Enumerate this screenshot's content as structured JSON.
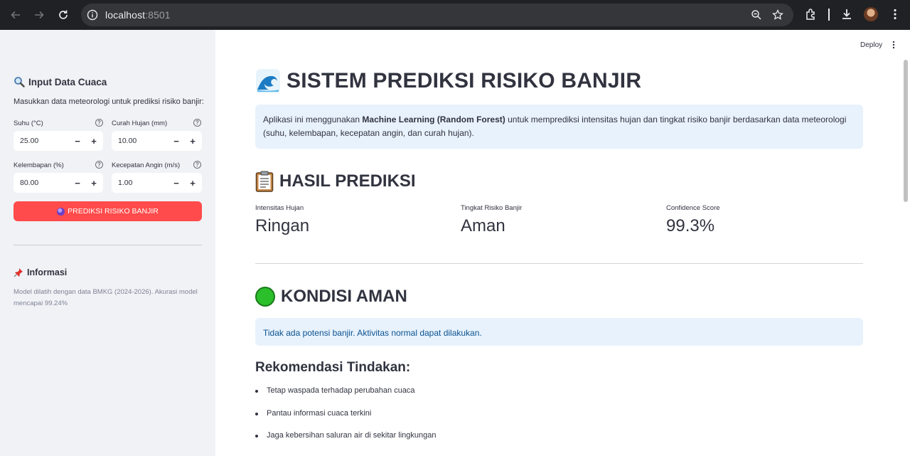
{
  "browser": {
    "url_host": "localhost",
    "url_port": ":8501"
  },
  "sidebar": {
    "title": "Input Data Cuaca",
    "description": "Masukkan data meteorologi untuk prediksi risiko banjir:",
    "fields": [
      {
        "label": "Suhu (°C)",
        "value": "25.00"
      },
      {
        "label": "Curah Hujan (mm)",
        "value": "10.00"
      },
      {
        "label": "Kelembapan (%)",
        "value": "80.00"
      },
      {
        "label": "Kecepatan Angin (m/s)",
        "value": "1.00"
      }
    ],
    "stepper_minus": "−",
    "stepper_plus": "+",
    "help_mark": "?",
    "predict_button": "PREDIKSI RISIKO BANJIR",
    "info_title": "Informasi",
    "info_text": "Model dilatih dengan data BMKG (2024-2026). Akurasi model mencapai 99.24%"
  },
  "header": {
    "deploy_label": "Deploy"
  },
  "main": {
    "title": "SISTEM PREDIKSI RISIKO BANJIR",
    "intro_pre": "Aplikasi ini menggunakan ",
    "intro_bold": "Machine Learning (Random Forest)",
    "intro_post": " untuk memprediksi intensitas hujan dan tingkat risiko banjir berdasarkan data meteorologi (suhu, kelembapan, kecepatan angin, dan curah hujan).",
    "result_title": "HASIL PREDIKSI",
    "metrics": [
      {
        "label": "Intensitas Hujan",
        "value": "Ringan"
      },
      {
        "label": "Tingkat Risiko Banjir",
        "value": "Aman"
      },
      {
        "label": "Confidence Score",
        "value": "99.3%"
      }
    ],
    "status_title": "KONDISI AMAN",
    "status_message": "Tidak ada potensi banjir. Aktivitas normal dapat dilakukan.",
    "recommendation_title": "Rekomendasi Tindakan:",
    "recommendations": [
      "Tetap waspada terhadap perubahan cuaca",
      "Pantau informasi cuaca terkini",
      "Jaga kebersihan saluran air di sekitar lingkungan"
    ]
  }
}
